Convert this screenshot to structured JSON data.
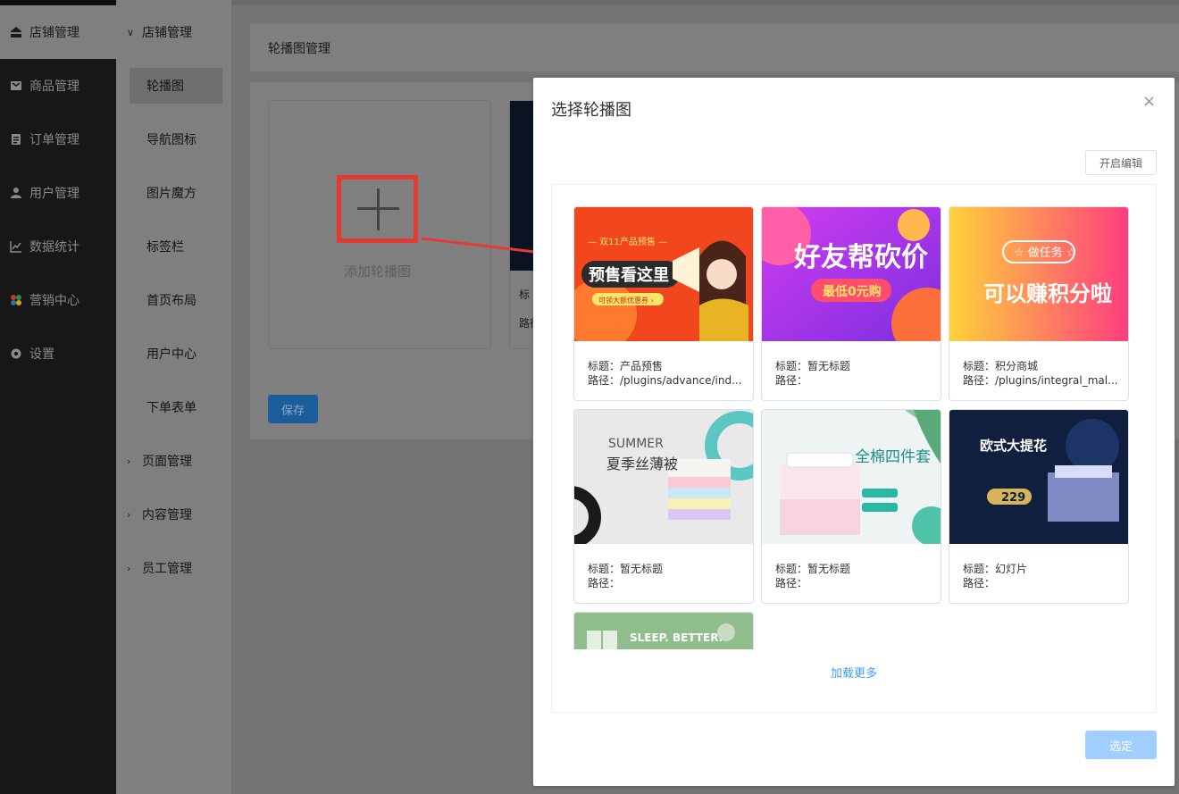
{
  "nav": {
    "items": [
      {
        "label": "店铺管理",
        "icon": "shop-icon",
        "active": true
      },
      {
        "label": "商品管理",
        "icon": "goods-icon"
      },
      {
        "label": "订单管理",
        "icon": "order-icon"
      },
      {
        "label": "用户管理",
        "icon": "user-icon"
      },
      {
        "label": "数据统计",
        "icon": "chart-icon"
      },
      {
        "label": "营销中心",
        "icon": "marketing-icon"
      },
      {
        "label": "设置",
        "icon": "gear-icon"
      }
    ]
  },
  "submenu": {
    "group_open": "店铺管理",
    "items": [
      "轮播图",
      "导航图标",
      "图片魔方",
      "标签栏",
      "首页布局",
      "用户中心",
      "下单表单"
    ],
    "groups_closed": [
      "页面管理",
      "内容管理",
      "员工管理"
    ]
  },
  "main": {
    "panel_title": "轮播图管理",
    "add_label": "添加轮播图",
    "bg_card_title": "标",
    "bg_card_path": "路径",
    "save_label": "保存"
  },
  "dialog": {
    "title": "选择轮播图",
    "close_glyph": "×",
    "edit_label": "开启编辑",
    "load_more": "加载更多",
    "confirm_label": "选定",
    "cards": [
      {
        "title": "标题：产品预售",
        "path": "路径：/plugins/advance/ind...",
        "banner": [
          "— 双11产品预售 —",
          "预售看这里",
          "可领大额优惠券 ›"
        ]
      },
      {
        "title": "标题：暂无标题",
        "path": "路径：",
        "banner": [
          "好友帮砍价",
          "最低0元购"
        ]
      },
      {
        "title": "标题：积分商城",
        "path": "路径：/plugins/integral_mal...",
        "banner": [
          "☆ 做任务 ☆",
          "可以赚积分啦"
        ]
      },
      {
        "title": "标题：暂无标题",
        "path": "路径：",
        "banner": [
          "SUMMER",
          "夏季丝薄被"
        ]
      },
      {
        "title": "标题：暂无标题",
        "path": "路径：",
        "banner": [
          "全棉四件套"
        ]
      },
      {
        "title": "标题：幻灯片",
        "path": "路径：",
        "banner": [
          "欧式大提花",
          "229"
        ]
      },
      {
        "banner": [
          "SLEEP. BETTER."
        ]
      }
    ]
  },
  "colors": {
    "nav_bg": "#171717",
    "accent": "#409eff",
    "highlight_red": "#e53a32",
    "confirm_disabled": "#a0cfff"
  }
}
